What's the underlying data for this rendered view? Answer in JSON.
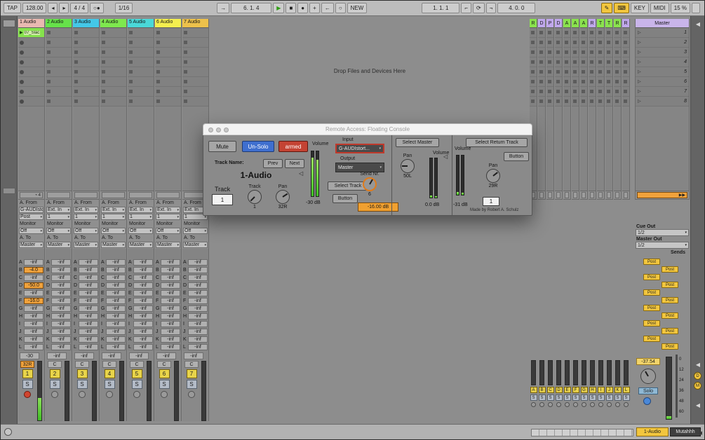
{
  "transport": {
    "tap": "TAP",
    "tempo": "128.00",
    "nudge_left": "◂",
    "nudge_right": "▸",
    "time_sig": "4 / 4",
    "metronome": "○●",
    "quantize": "1/16",
    "follow": "→",
    "position": "6. 1. 4",
    "play": "▶",
    "stop": "■",
    "record": "●",
    "overdub": "+",
    "back_to_arrangement": "←",
    "session_record": "○",
    "new_label": "NEW",
    "loop_start": "1. 1. 1",
    "punch_in": "⌐",
    "loop": "⟳",
    "punch_out": "¬",
    "loop_length": "4. 0. 0",
    "draw": "✎",
    "keyboard": "⌨",
    "key_label": "KEY",
    "midi_label": "MIDI",
    "cpu": "15 %"
  },
  "session": {
    "drop_text": "Drop Files and Devices Here",
    "scenes": [
      "1",
      "2",
      "3",
      "4",
      "5",
      "6",
      "7",
      "8"
    ],
    "master_label": "Master",
    "master_color": "#c9b5ea"
  },
  "mixer": {
    "from_label": "A. From",
    "monitor_label": "Monitor",
    "to_label": "A. To",
    "solo_label": "S",
    "send_letters": [
      "A",
      "B",
      "C",
      "D",
      "E",
      "F",
      "G",
      "H",
      "I",
      "J",
      "K",
      "L"
    ],
    "send_default": "-inf"
  },
  "tracks": [
    {
      "id": "1",
      "name": "1 Audio",
      "color": "#e9b9b1",
      "input": "G-AUDIsto",
      "channel": "Post",
      "monitor": "Off",
      "output": "Master",
      "sends": {
        "B": "-4.0",
        "D": "-50.0",
        "F": "-16.0"
      },
      "volume": "-30",
      "pan": "32R",
      "pan_active": true,
      "armed": true,
      "meter": 38,
      "clip": {
        "row": 1,
        "name": "07_Slac",
        "color": "#86e24d"
      },
      "status": "4"
    },
    {
      "id": "2",
      "name": "2 Audio",
      "color": "#66e24a",
      "input": "Ext. In",
      "channel": "1",
      "monitor": "Off",
      "output": "Master",
      "volume": "-inf",
      "pan": "C",
      "meter": 0
    },
    {
      "id": "3",
      "name": "3 Audio",
      "color": "#44c8e8",
      "input": "Ext. In",
      "channel": "1",
      "monitor": "Off",
      "output": "Master",
      "volume": "-inf",
      "pan": "C",
      "meter": 0
    },
    {
      "id": "4",
      "name": "4 Audio",
      "color": "#7ee84e",
      "input": "Ext. In",
      "channel": "1",
      "monitor": "Off",
      "output": "Master",
      "volume": "-inf",
      "pan": "C",
      "meter": 0
    },
    {
      "id": "5",
      "name": "5 Audio",
      "color": "#4ad8d8",
      "input": "Ext. In",
      "channel": "1",
      "monitor": "Off",
      "output": "Master",
      "volume": "-inf",
      "pan": "C",
      "meter": 0
    },
    {
      "id": "6",
      "name": "6 Audio",
      "color": "#f4ef4e",
      "input": "Ext. In",
      "channel": "1",
      "monitor": "Off",
      "output": "Master",
      "volume": "-inf",
      "pan": "C",
      "meter": 0
    },
    {
      "id": "7",
      "name": "7 Audio",
      "color": "#edc14b",
      "input": "Ext. In",
      "channel": "1",
      "monitor": "Off",
      "output": "Master",
      "volume": "-inf",
      "pan": "C",
      "meter": 0
    }
  ],
  "returns": {
    "headers": [
      {
        "letter": "R",
        "color": "#8ae24e"
      },
      {
        "letter": "D",
        "color": "#c0a8ec"
      },
      {
        "letter": "P",
        "color": "#c0a8ec"
      },
      {
        "letter": "D",
        "color": "#c0a8ec"
      },
      {
        "letter": "A",
        "color": "#8ae24e"
      },
      {
        "letter": "A",
        "color": "#8ae24e"
      },
      {
        "letter": "A",
        "color": "#8ae24e"
      },
      {
        "letter": "R",
        "color": "#c0a8ec"
      },
      {
        "letter": "T",
        "color": "#8ae24e"
      },
      {
        "letter": "T",
        "color": "#8ae24e"
      },
      {
        "letter": "R",
        "color": "#8ae24e"
      },
      {
        "letter": "R",
        "color": "#c0a8ec"
      }
    ],
    "strip_letters": [
      "A",
      "B",
      "C",
      "D",
      "E",
      "F",
      "G",
      "H",
      "I",
      "J",
      "K",
      "L"
    ]
  },
  "right_panel": {
    "cue_out_label": "Cue Out",
    "cue_out_value": "1/2",
    "master_out_label": "Master Out",
    "master_out_value": "1/2",
    "sends_label": "Sends",
    "post_label": "Post",
    "master_value": "-37.54",
    "master_solo": "Solo",
    "scale": [
      "0",
      "12",
      "24",
      "36",
      "48",
      "60"
    ]
  },
  "right_edge": {
    "collapse_arrow": "◀",
    "toggles": [
      "D",
      "M"
    ]
  },
  "console": {
    "title": "Remote Access: Floating Console",
    "mute": "Mute",
    "unsolo": "Un-Solo",
    "armed": "armed",
    "track_name_label": "Track Name:",
    "prev": "Prev",
    "next": "Next",
    "track_name": "1-Audio",
    "track_box_label": "Track",
    "track_box_value": "1",
    "track_knob_label": "Track",
    "track_knob_value": "1",
    "pan_label": "Pan",
    "pan_value": "32R",
    "volume_label": "Volume",
    "volume_value": "-30 dB",
    "input_label": "Input",
    "input_value": "G-AUDIstort...",
    "output_label": "Output",
    "output_value": "Master",
    "select_track": "Select Track",
    "button": "Button",
    "send_nr_label": "Send Nr.",
    "send_nr_value": "6",
    "send_db": "-16.00 dB",
    "select_master": "Select Master",
    "master_volume_label": "Volume",
    "master_pan_label": "Pan",
    "master_pan_value": "50L",
    "master_db": "0.0 dB",
    "select_return": "Select Return Track",
    "return_button": "Button",
    "return_volume_label": "Volume",
    "return_db": "-31 dB",
    "return_pan_label": "Pan",
    "return_pan_value": "29R",
    "return_number": "1",
    "credit": "Made by Robert A. Schulz"
  },
  "statusbar": {
    "selected_clip": "1-Audio",
    "message": "Mutahhh"
  }
}
